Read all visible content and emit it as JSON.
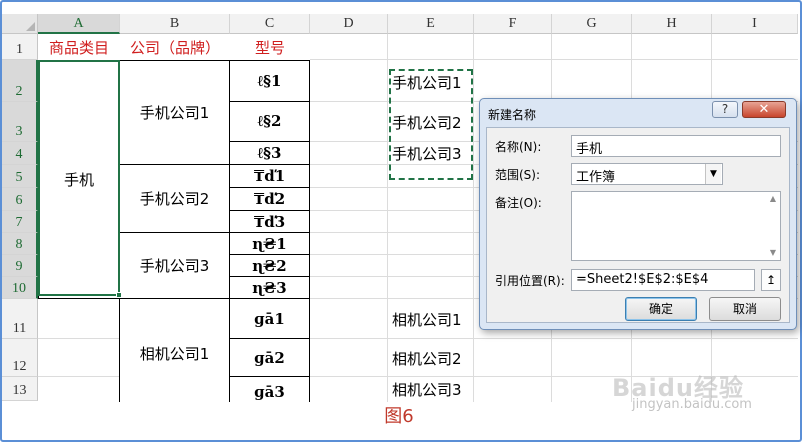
{
  "columns": [
    "A",
    "B",
    "C",
    "D",
    "E",
    "F",
    "G",
    "H",
    "I"
  ],
  "rows": [
    "1",
    "2",
    "3",
    "4",
    "5",
    "6",
    "7",
    "8",
    "9",
    "10",
    "11",
    "12",
    "13"
  ],
  "header_row": {
    "a": "商品类目",
    "b": "公司（品牌）",
    "c": "型号"
  },
  "category": "手机",
  "companies": [
    "手机公司1",
    "手机公司2",
    "手机公司3",
    "相机公司1"
  ],
  "models": [
    "ℓ§1",
    "ℓ§2",
    "ℓ§3",
    "₸ď1",
    "₸ď2",
    "₸ď3",
    "ɳ₴1",
    "ɳ₴2",
    "ɳ₴3",
    "ɡā1",
    "ɡā2",
    "ɡā3"
  ],
  "column_e": [
    "手机公司1",
    "手机公司2",
    "手机公司3",
    "相机公司1",
    "相机公司2",
    "相机公司3"
  ],
  "dialog": {
    "title": "新建名称",
    "help": "?",
    "close": "✕",
    "name_label": "名称(N):",
    "name_value": "手机",
    "scope_label": "范围(S):",
    "scope_value": "工作簿",
    "comment_label": "备注(O):",
    "ref_label": "引用位置(R):",
    "ref_value": "=Sheet2!$E$2:$E$4",
    "collapse_icon": "↥",
    "ok": "确定",
    "cancel": "取消"
  },
  "caption": "图6",
  "watermark": "Baidu经验",
  "watermark_url": "jingyan.baidu.com",
  "colors": {
    "accent_green": "#217346",
    "header_red": "#d01f1f",
    "caption_red": "#c0392b",
    "frame_blue": "#5b8fd6"
  }
}
